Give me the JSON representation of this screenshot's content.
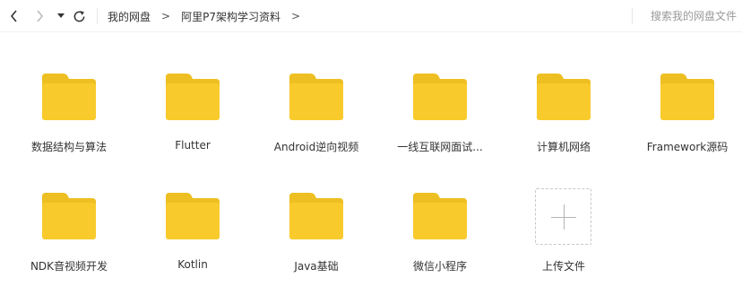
{
  "toolbar": {
    "back_icon": "chevron-left-icon",
    "forward_icon": "chevron-right-icon",
    "history_icon": "caret-down-icon",
    "refresh_icon": "refresh-icon"
  },
  "breadcrumb": {
    "items": [
      "我的网盘",
      "阿里P7架构学习资料"
    ],
    "separator": ">"
  },
  "search": {
    "placeholder": "搜索我的网盘文件"
  },
  "colors": {
    "folder_back": "#EDBF22",
    "folder_front": "#F8CA2C",
    "text": "#333333",
    "placeholder": "#9A9A9A"
  },
  "folders": [
    {
      "name": "数据结构与算法"
    },
    {
      "name": "Flutter"
    },
    {
      "name": "Android逆向视频"
    },
    {
      "name": "一线互联网面试..."
    },
    {
      "name": "计算机网络"
    },
    {
      "name": "Framework源码"
    },
    {
      "name": "NDK音视频开发"
    },
    {
      "name": "Kotlin"
    },
    {
      "name": "Java基础"
    },
    {
      "name": "微信小程序"
    }
  ],
  "upload": {
    "label": "上传文件",
    "icon": "plus-icon"
  }
}
